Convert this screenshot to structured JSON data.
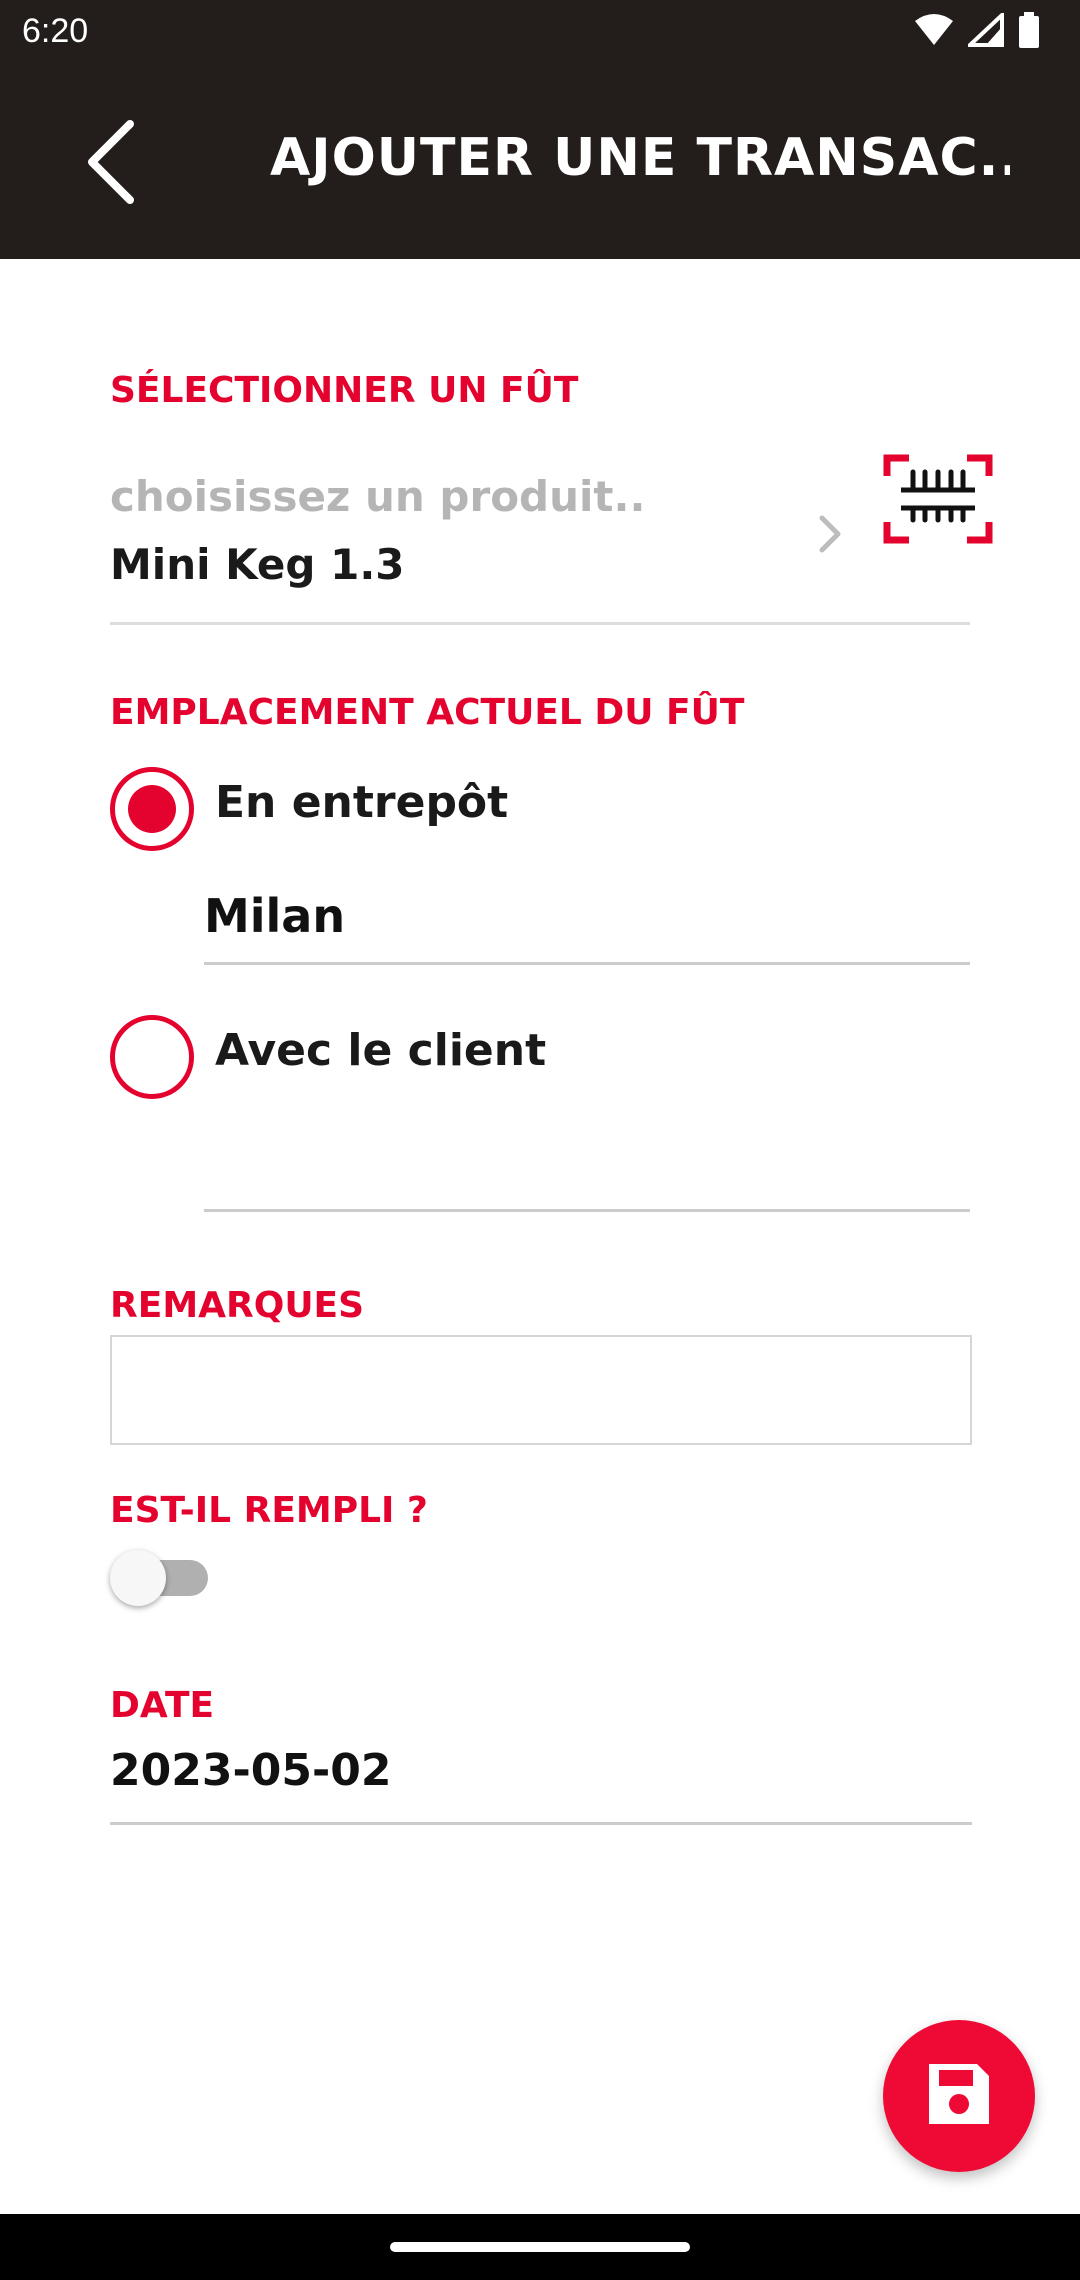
{
  "status_bar": {
    "time": "6:20",
    "icons": [
      "wifi-icon",
      "signal-icon",
      "battery-icon"
    ]
  },
  "app_bar": {
    "title": "AJOUTER UNE TRANSAC...",
    "back_icon": "back-arrow-icon"
  },
  "form": {
    "keg_section": {
      "label": "SÉLECTIONNER UN FÛT",
      "placeholder": "choisissez un produit..",
      "value": "Mini Keg 1.3",
      "icons": [
        "chevron-right-icon",
        "barcode-scan-icon"
      ]
    },
    "location_section": {
      "label": "EMPLACEMENT ACTUEL DU FÛT",
      "options": [
        {
          "label": "En entrepôt",
          "selected": true,
          "field_value": "Milan"
        },
        {
          "label": "Avec le client",
          "selected": false,
          "field_value": ""
        }
      ]
    },
    "remarks": {
      "label": "REMARQUES",
      "value": ""
    },
    "filled": {
      "label": "EST-IL REMPLI ?",
      "checked": false
    },
    "date": {
      "label": "DATE",
      "value": "2023-05-02"
    }
  },
  "fab": {
    "icon": "save-icon"
  },
  "colors": {
    "accent": "#e4032e",
    "app_bar": "#231e1b"
  }
}
